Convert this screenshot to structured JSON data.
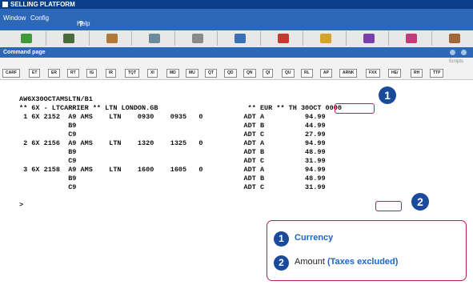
{
  "window": {
    "title": "SELLING PLATFORM"
  },
  "menu": {
    "items": [
      "Window",
      "Config",
      "Help"
    ],
    "help_mark": "?"
  },
  "toolbar": {
    "icons": [
      {
        "name": "cube-icon",
        "color": "#3f9a3c"
      },
      {
        "name": "calculator-icon",
        "color": "#4a6b3a"
      },
      {
        "name": "person-icon",
        "color": "#b07a3a"
      },
      {
        "name": "terminal-icon",
        "color": "#6b8aa0"
      },
      {
        "name": "gear-icon",
        "color": "#8a8a8a"
      },
      {
        "name": "car-icon",
        "color": "#3b6fb5"
      },
      {
        "name": "passenger-icon",
        "color": "#c23b2e"
      },
      {
        "name": "puzzle-icon",
        "color": "#d4a32a"
      },
      {
        "name": "palette-icon",
        "color": "#7a3fae"
      },
      {
        "name": "pen-icon",
        "color": "#c23b7a"
      },
      {
        "name": "clip-icon",
        "color": "#a0683a"
      }
    ]
  },
  "command_page": {
    "title": "Command page",
    "scripts_label": "Scripts"
  },
  "function_keys": [
    "CARF",
    "ET",
    "ER",
    "RT",
    "IG",
    "IR",
    "TQT",
    "XI",
    "MD",
    "MU",
    "QT",
    "QD",
    "QN",
    "QI",
    "QU",
    "RL",
    "AP",
    "ARNK",
    "FXX",
    "HE/",
    "RH",
    "TTP"
  ],
  "terminal": {
    "lines": [
      "AW6X30OCTAMSLTN/B1",
      "** 6X - LTCARRIER ** LTN LONDON.GB                      ** EUR ** TH 30OCT 0000",
      " 1 6X 2152  A9 AMS    LTN    0930    0935   0          ADT A          94.99",
      "            B9                                         ADT B          44.99",
      "            C9                                         ADT C          27.99",
      " 2 6X 2156  A9 AMS    LTN    1320    1325   0          ADT A          94.99",
      "            B9                                         ADT B          48.99",
      "            C9                                         ADT C          31.99",
      " 3 6X 2158  A9 AMS    LTN    1600    1605   0          ADT A          94.99",
      "            B9                                         ADT B          48.99",
      "            C9                                         ADT C          31.99",
      "",
      ">"
    ]
  },
  "callouts": {
    "badge1": "1",
    "badge2": "2"
  },
  "legend": {
    "item1": {
      "num": "1",
      "label": "Currency"
    },
    "item2": {
      "num": "2",
      "label_plain": "Amount",
      "label_accent": "(Taxes excluded)"
    }
  },
  "colors": {
    "titlebar": "#0a3f8c",
    "menubar": "#2d67b8",
    "highlight": "#c2185b",
    "badge": "#1a4a9c",
    "accent": "#1a67c9"
  }
}
